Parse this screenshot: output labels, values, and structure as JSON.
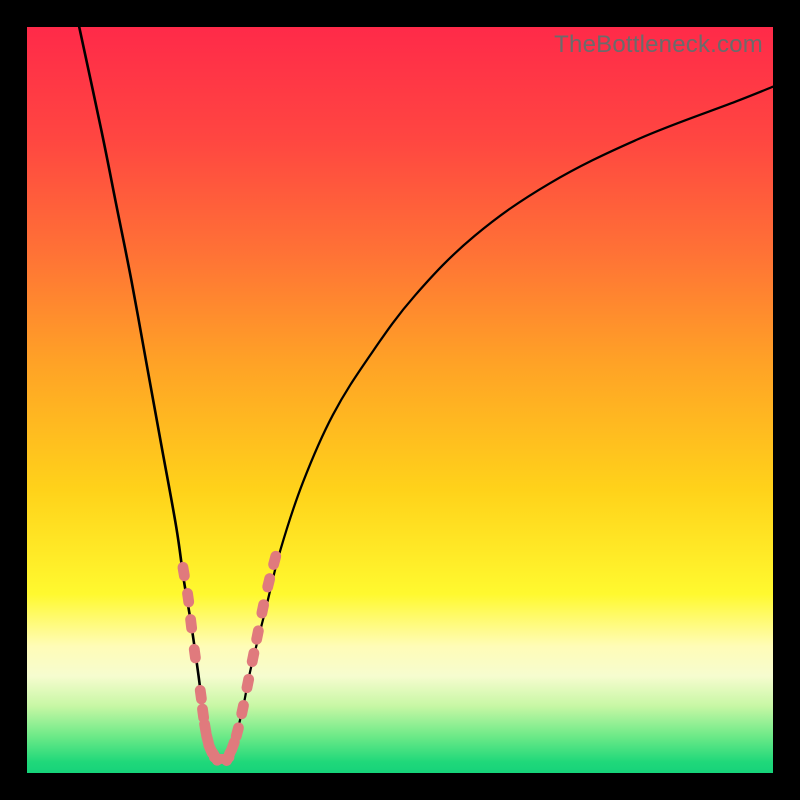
{
  "watermark": "TheBottleneck.com",
  "colors": {
    "frame": "#000000",
    "curve": "#000000",
    "marker_fill": "#e07a7d",
    "gradient_stops": [
      {
        "offset": 0.0,
        "color": "#ff2a49"
      },
      {
        "offset": 0.15,
        "color": "#ff4641"
      },
      {
        "offset": 0.3,
        "color": "#ff7136"
      },
      {
        "offset": 0.45,
        "color": "#ffa226"
      },
      {
        "offset": 0.62,
        "color": "#ffd21a"
      },
      {
        "offset": 0.76,
        "color": "#fff92f"
      },
      {
        "offset": 0.83,
        "color": "#fffcb7"
      },
      {
        "offset": 0.87,
        "color": "#f6fccf"
      },
      {
        "offset": 0.91,
        "color": "#c8f7a5"
      },
      {
        "offset": 0.95,
        "color": "#6eea88"
      },
      {
        "offset": 0.985,
        "color": "#20d87a"
      },
      {
        "offset": 1.0,
        "color": "#16d37a"
      }
    ]
  },
  "chart_data": {
    "type": "line",
    "title": "",
    "xlabel": "",
    "ylabel": "",
    "xlim": [
      0,
      100
    ],
    "ylim": [
      0,
      100
    ],
    "series": [
      {
        "name": "left-curve",
        "x": [
          7,
          10,
          12,
          14,
          16,
          18,
          20,
          21,
          22,
          23,
          23.5,
          24,
          25
        ],
        "y": [
          100,
          86,
          76,
          66,
          55,
          44,
          33,
          26,
          20,
          13,
          9,
          5,
          2
        ]
      },
      {
        "name": "right-curve",
        "x": [
          27,
          28,
          29,
          30,
          32,
          34,
          37,
          41,
          46,
          52,
          60,
          70,
          82,
          95,
          100
        ],
        "y": [
          2,
          5,
          9,
          14,
          22,
          30,
          39,
          48,
          56,
          64,
          72,
          79,
          85,
          90,
          92
        ]
      },
      {
        "name": "left-markers",
        "x": [
          21.0,
          21.6,
          22.0,
          22.5,
          23.3,
          23.6,
          23.9,
          24.2,
          24.6,
          25.2
        ],
        "y": [
          27.0,
          23.5,
          20.0,
          16.0,
          10.5,
          8.0,
          6.0,
          4.5,
          3.2,
          2.2
        ]
      },
      {
        "name": "right-markers",
        "x": [
          27.0,
          27.6,
          28.2,
          28.9,
          29.6,
          30.3,
          30.9,
          31.6,
          32.4,
          33.2
        ],
        "y": [
          2.2,
          3.6,
          5.5,
          8.5,
          12.0,
          15.5,
          18.5,
          22.0,
          25.5,
          28.5
        ]
      },
      {
        "name": "bottom-markers",
        "x": [
          25.3,
          25.7,
          26.1,
          26.5,
          26.9
        ],
        "y": [
          2.0,
          1.9,
          1.9,
          1.9,
          2.0
        ]
      }
    ]
  }
}
